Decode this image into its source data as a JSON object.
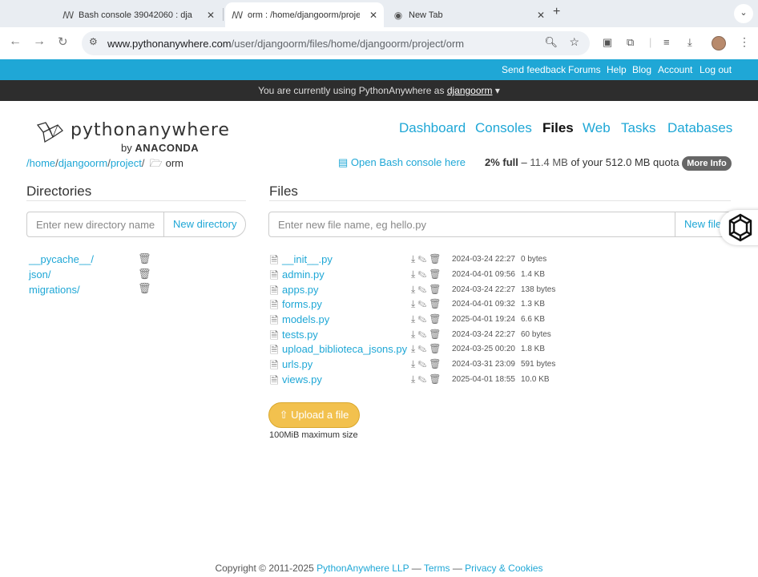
{
  "browser": {
    "tabs": [
      {
        "title": "Bash console 39042060 : dja",
        "close": "✕"
      },
      {
        "title": "orm : /home/djangoorm/proje",
        "close": "✕"
      },
      {
        "title": "New Tab",
        "close": "✕"
      }
    ],
    "new_tab": "+",
    "tab_menu": "⌄",
    "url_host": "www.pythonanywhere.com",
    "url_path": "/user/djangoorm/files/home/djangoorm/project/orm"
  },
  "topbar": {
    "links": [
      "Send feedback",
      "Forums",
      "Help",
      "Blog",
      "Account",
      "Log out"
    ]
  },
  "userbar": {
    "prefix": "You are currently using PythonAnywhere as",
    "username": "djangoorm",
    "caret": "▾"
  },
  "logo": {
    "name": "pythonanywhere",
    "by": "by",
    "company": "ANACONDA"
  },
  "nav": [
    "Dashboard",
    "Consoles",
    "Files",
    "Web",
    "Tasks",
    "Databases"
  ],
  "breadcrumb": {
    "parts": [
      "/home",
      "djangoorm",
      "project"
    ],
    "current": "orm"
  },
  "bash_link": "Open Bash console here",
  "quota": {
    "percent": "2% full",
    "dash": " – ",
    "used": "11.4 MB",
    "rest": " of your 512.0 MB quota",
    "more_info": "More Info"
  },
  "directories": {
    "heading": "Directories",
    "placeholder": "Enter new directory name",
    "button": "New directory",
    "items": [
      "__pycache__/",
      "json/",
      "migrations/"
    ]
  },
  "files": {
    "heading": "Files",
    "placeholder": "Enter new file name, eg hello.py",
    "button": "New file",
    "items": [
      {
        "name": "__init__.py",
        "date": "2024-03-24 22:27",
        "size": "0 bytes"
      },
      {
        "name": "admin.py",
        "date": "2024-04-01 09:56",
        "size": "1.4 KB"
      },
      {
        "name": "apps.py",
        "date": "2024-03-24 22:27",
        "size": "138 bytes"
      },
      {
        "name": "forms.py",
        "date": "2024-04-01 09:32",
        "size": "1.3 KB"
      },
      {
        "name": "models.py",
        "date": "2025-04-01 19:24",
        "size": "6.6 KB"
      },
      {
        "name": "tests.py",
        "date": "2024-03-24 22:27",
        "size": "60 bytes"
      },
      {
        "name": "upload_biblioteca_jsons.py",
        "date": "2024-03-25 00:20",
        "size": "1.8 KB"
      },
      {
        "name": "urls.py",
        "date": "2024-03-31 23:09",
        "size": "591 bytes"
      },
      {
        "name": "views.py",
        "date": "2025-04-01 18:55",
        "size": "10.0 KB"
      }
    ],
    "upload_button": "Upload a file",
    "upload_note": "100MiB maximum size"
  },
  "footer": {
    "copyright": "Copyright © 2011-2025",
    "company": "PythonAnywhere LLP",
    "sep1": " — ",
    "terms": "Terms",
    "sep2": " — ",
    "privacy": "Privacy & Cookies"
  }
}
